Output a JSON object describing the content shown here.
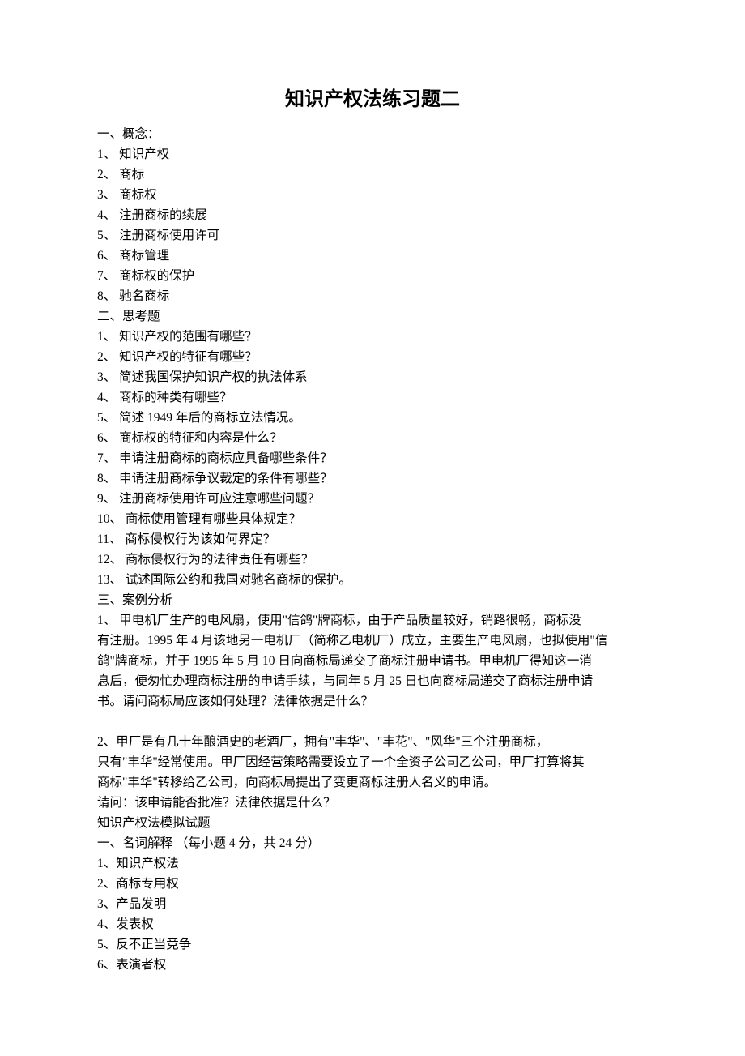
{
  "title": "知识产权法练习题二",
  "section1": {
    "heading": "一、概念：",
    "items": [
      "1、 知识产权",
      "2、 商标",
      "3、 商标权",
      "4、 注册商标的续展",
      "5、 注册商标使用许可",
      "6、 商标管理",
      "7、 商标权的保护",
      "8、 驰名商标"
    ]
  },
  "section2": {
    "heading": "二、思考题",
    "items": [
      "1、 知识产权的范围有哪些？",
      "2、 知识产权的特征有哪些？",
      "3、 简述我国保护知识产权的执法体系",
      "4、 商标的种类有哪些？",
      "5、 简述 1949 年后的商标立法情况。",
      "6、 商标权的特征和内容是什么？",
      "7、 申请注册商标的商标应具备哪些条件？",
      "8、 申请注册商标争议裁定的条件有哪些？",
      "9、 注册商标使用许可应注意哪些问题？",
      "10、 商标使用管理有哪些具体规定？",
      "11、 商标侵权行为该如何界定？",
      "12、 商标侵权行为的法律责任有哪些？",
      "13、 试述国际公约和我国对驰名商标的保护。"
    ]
  },
  "section3": {
    "heading": "三、案例分析",
    "case1": [
      "1、 甲电机厂生产的电风扇，使用\"信鸽\"牌商标，由于产品质量较好，销路很畅，商标没",
      "有注册。1995 年 4 月该地另一电机厂（简称乙电机厂）成立，主要生产电风扇，也拟使用\"信",
      "鸽\"牌商标，并于 1995 年 5 月 10 日向商标局递交了商标注册申请书。甲电机厂得知这一消",
      "息后，便匆忙办理商标注册的申请手续，与同年 5 月 25 日也向商标局递交了商标注册申请",
      "书。请问商标局应该如何处理？法律依据是什么？"
    ],
    "case2": [
      "2、甲厂是有几十年酿酒史的老酒厂，拥有\"丰华\"、\"丰花\"、\"风华\"三个注册商标，",
      "只有\"丰华\"经常使用。甲厂因经营策略需要设立了一个全资子公司乙公司，甲厂打算将其",
      "商标\"丰华\"转移给乙公司，向商标局提出了变更商标注册人名义的申请。",
      "请问：该申请能否批准？法律依据是什么？"
    ]
  },
  "mockTitle": "知识产权法模拟试题",
  "mockSection1": {
    "heading": "一、名词解释 （每小题 4 分，共 24 分）",
    "items": [
      "1、知识产权法",
      "2、商标专用权",
      "3、产品发明",
      "4、发表权",
      "5、反不正当竞争",
      "6、表演者权"
    ]
  }
}
